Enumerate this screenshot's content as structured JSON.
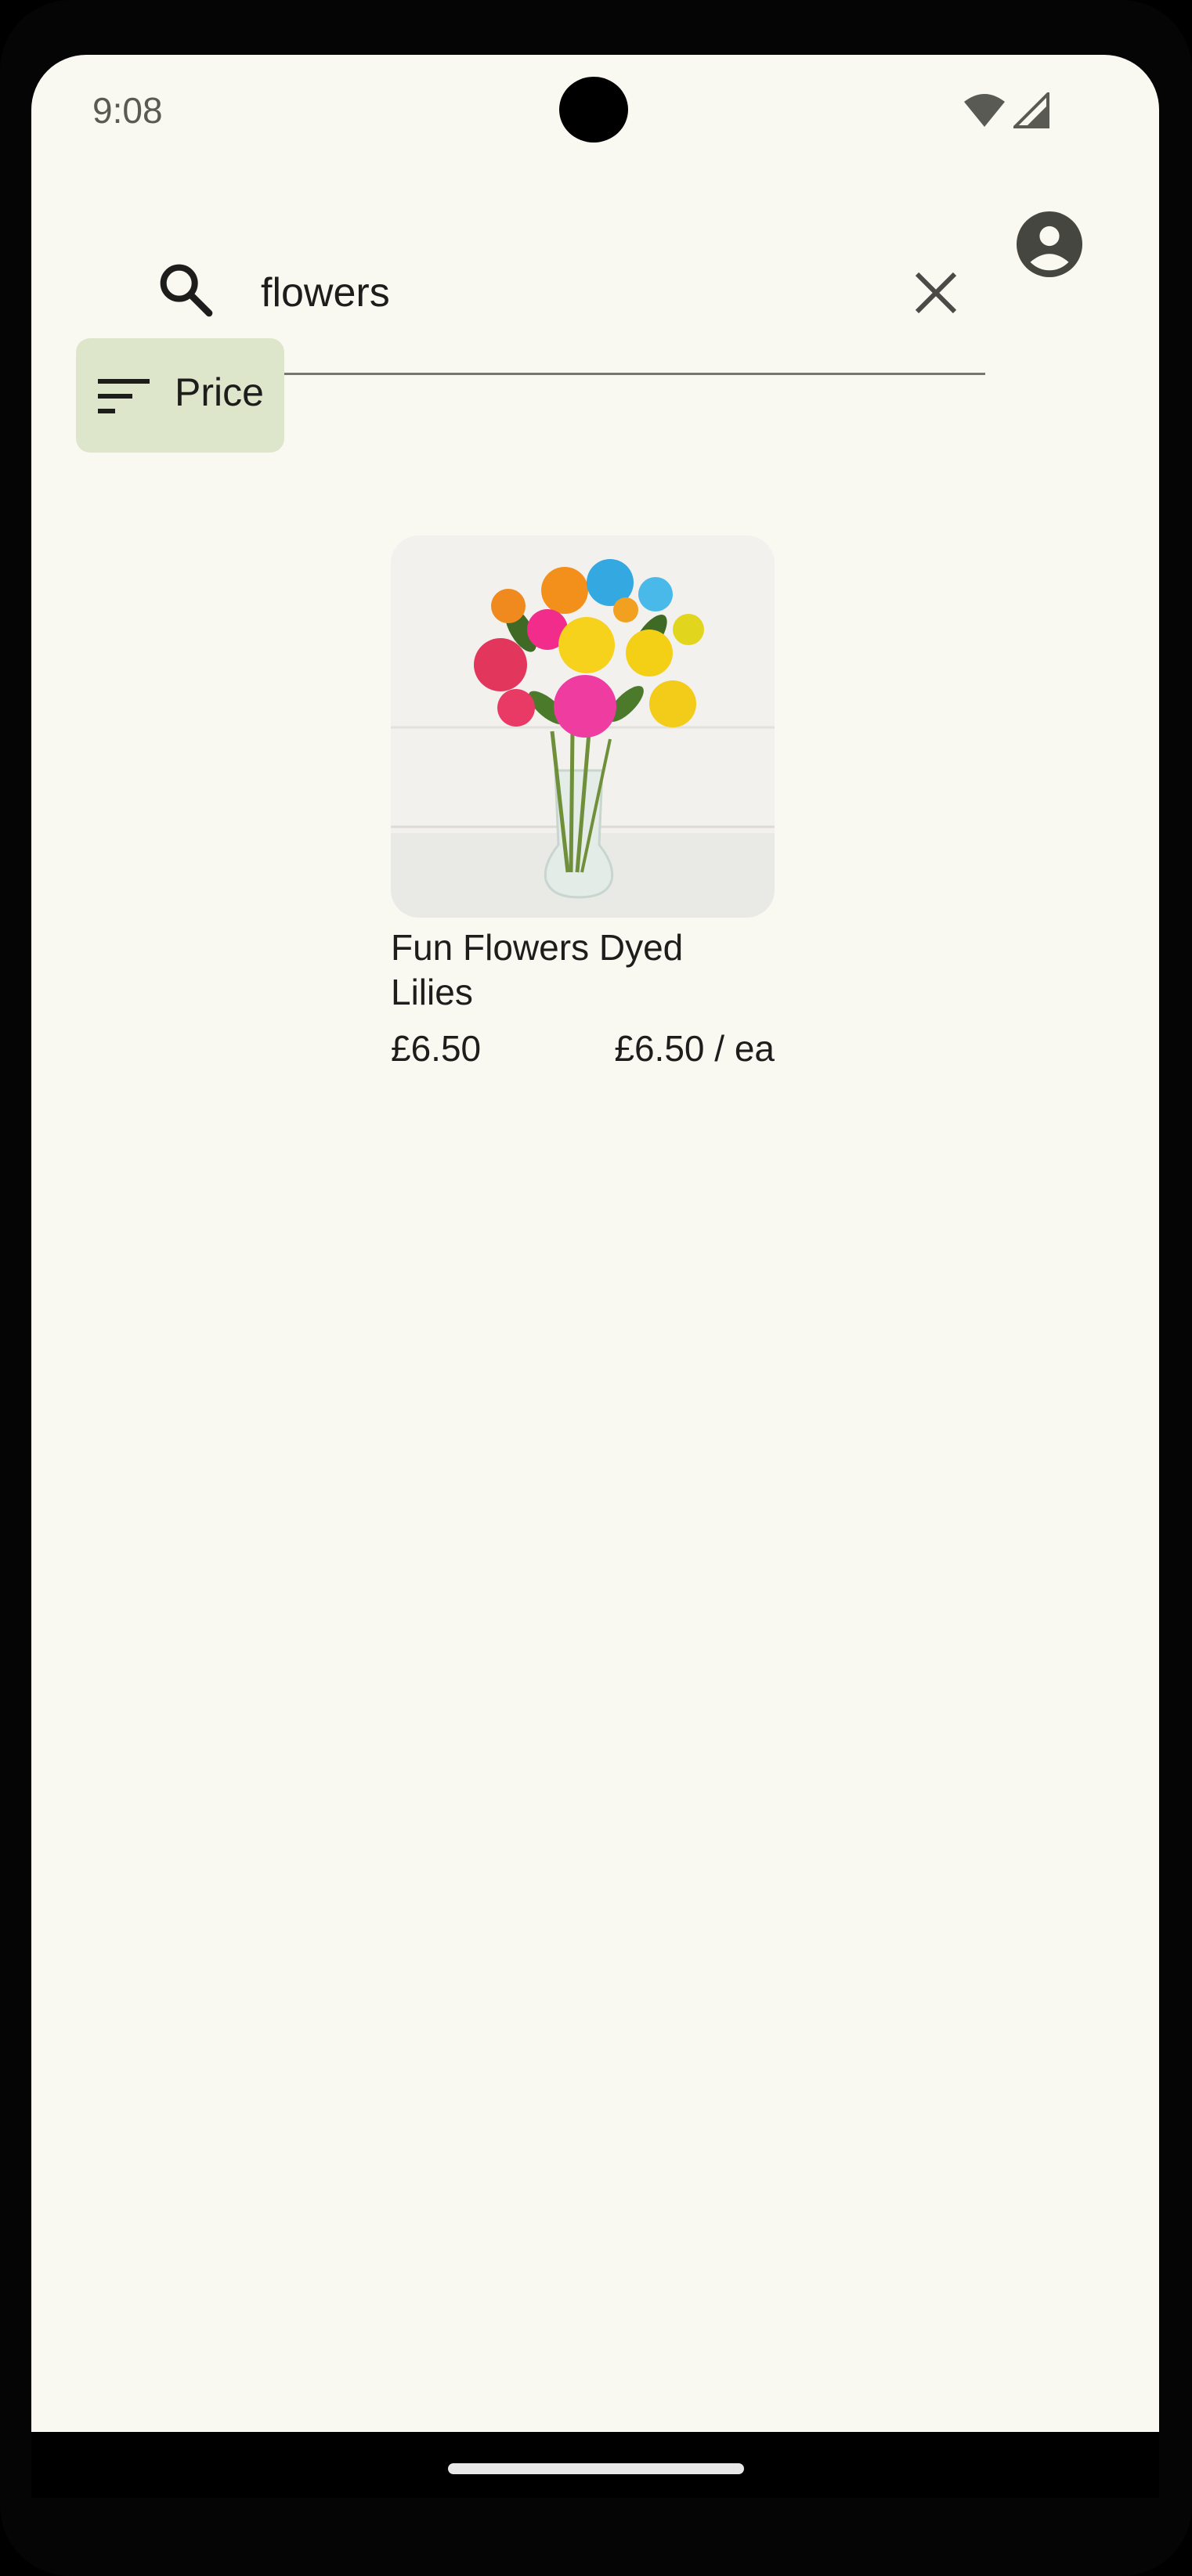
{
  "status_bar": {
    "time": "9:08",
    "icons": [
      "wifi-icon",
      "cellular-signal-icon"
    ]
  },
  "search": {
    "value": "flowers",
    "placeholder": "",
    "icon": "search-icon",
    "clear_icon": "close-icon"
  },
  "account": {
    "icon": "account-circle-icon"
  },
  "filter": {
    "label": "Price",
    "icon": "sort-icon"
  },
  "products": [
    {
      "name": "Fun Flowers Dyed Lilies",
      "price": "£6.50",
      "unit_price": "£6.50 / ea",
      "image": "bouquet-of-multicolored-lilies-in-glass-vase"
    }
  ],
  "colors": {
    "background": "#f9f8f1",
    "chip": "#dde6cb",
    "text": "#1d1d1b"
  }
}
